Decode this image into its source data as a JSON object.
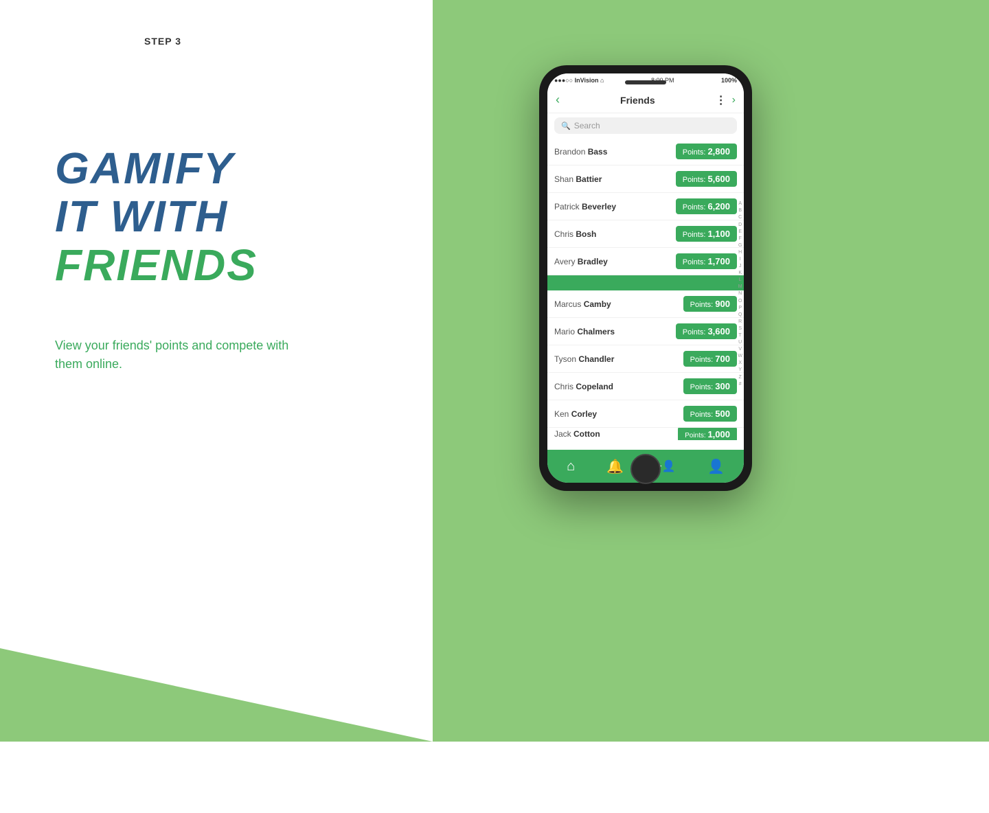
{
  "left": {
    "step_label": "STEP 3",
    "headline_line1": "GAMIFY",
    "headline_line2": "IT WITH",
    "headline_line3": "FRIENDS",
    "subtext": "View your friends' points and compete with them online."
  },
  "phone": {
    "status": {
      "left": "●●●○○ InVision ⌂",
      "center": "8:00 PM",
      "right": "100%"
    },
    "nav": {
      "back": "‹",
      "title": "Friends",
      "dots": "⋮",
      "forward": "›"
    },
    "search_placeholder": "Search",
    "friends_section_a": [
      {
        "first": "Brandon",
        "last": "Bass",
        "points": "2,800"
      },
      {
        "first": "Shan",
        "last": "Battier",
        "points": "5,600"
      },
      {
        "first": "Patrick",
        "last": "Beverley",
        "points": "6,200"
      },
      {
        "first": "Chris",
        "last": "Bosh",
        "points": "1,100"
      },
      {
        "first": "Avery",
        "last": "Bradley",
        "points": "1,700"
      }
    ],
    "friends_section_c": [
      {
        "first": "Marcus",
        "last": "Camby",
        "points": "900"
      },
      {
        "first": "Mario",
        "last": "Chalmers",
        "points": "3,600"
      },
      {
        "first": "Tyson",
        "last": "Chandler",
        "points": "700"
      },
      {
        "first": "Chris",
        "last": "Copeland",
        "points": "300"
      },
      {
        "first": "Ken",
        "last": "Corley",
        "points": "500"
      },
      {
        "first": "Jack",
        "last": "Cotton",
        "points": "1,000"
      }
    ],
    "points_label": "Points: ",
    "alphabet": [
      "A",
      "B",
      "C",
      "D",
      "E",
      "F",
      "G",
      "H",
      "I",
      "J",
      "K",
      "L",
      "M",
      "N",
      "O",
      "P",
      "Q",
      "R",
      "S",
      "T",
      "U",
      "V",
      "W",
      "X",
      "Y",
      "Z",
      "#"
    ],
    "tab_icons": [
      "⌂",
      "🔔",
      "+👤",
      "👤"
    ]
  }
}
